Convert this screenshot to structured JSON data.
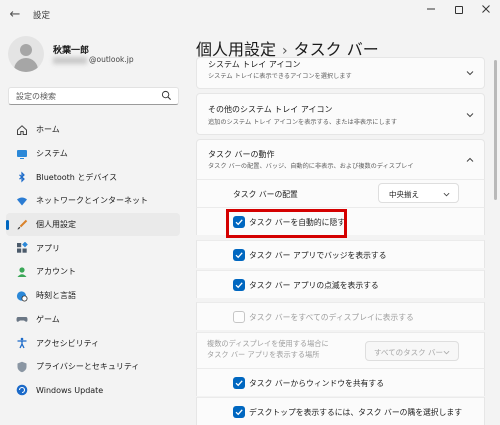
{
  "window": {
    "title": "設定",
    "back_glyph": "←"
  },
  "user": {
    "name": "秋葉一郎",
    "email_suffix": "@outlook.jp"
  },
  "search": {
    "placeholder": "設定の検索"
  },
  "sidebar": {
    "items": [
      {
        "label": "ホーム",
        "icon": "home-icon",
        "active": false
      },
      {
        "label": "システム",
        "icon": "monitor-icon",
        "active": false
      },
      {
        "label": "Bluetooth とデバイス",
        "icon": "bluetooth-icon",
        "active": false
      },
      {
        "label": "ネットワークとインターネット",
        "icon": "wifi-icon",
        "active": false
      },
      {
        "label": "個人用設定",
        "icon": "brush-icon",
        "active": true
      },
      {
        "label": "アプリ",
        "icon": "apps-icon",
        "active": false
      },
      {
        "label": "アカウント",
        "icon": "person-icon",
        "active": false
      },
      {
        "label": "時刻と言語",
        "icon": "globe-clock-icon",
        "active": false
      },
      {
        "label": "ゲーム",
        "icon": "gamepad-icon",
        "active": false
      },
      {
        "label": "アクセシビリティ",
        "icon": "accessibility-icon",
        "active": false
      },
      {
        "label": "プライバシーとセキュリティ",
        "icon": "shield-icon",
        "active": false
      },
      {
        "label": "Windows Update",
        "icon": "update-icon",
        "active": false
      }
    ]
  },
  "header": {
    "parent": "個人用設定",
    "separator": "›",
    "current": "タスク バー"
  },
  "cards": {
    "tray_icons": {
      "title": "システム トレイ アイコン",
      "subtitle": "システム トレイに表示できるアイコンを選択します"
    },
    "other_tray_icons": {
      "title": "その他のシステム トレイ アイコン",
      "subtitle": "追加のシステム トレイ アイコンを表示する、または非表示にします"
    },
    "behaviors": {
      "title": "タスク バーの動作",
      "subtitle": "タスク バーの配置、バッジ、自動的に非表示、および複数のディスプレイ"
    }
  },
  "behaviors": {
    "alignment": {
      "label": "タスク バーの配置",
      "value": "中央揃え"
    },
    "autohide": {
      "label": "タスク バーを自動的に隠す",
      "checked": true
    },
    "badges": {
      "label": "タスク バー アプリでバッジを表示する",
      "checked": true
    },
    "flashing": {
      "label": "タスク バー アプリの点滅を表示する",
      "checked": true
    },
    "all_displays": {
      "label": "タスク バーをすべてのディスプレイに表示する",
      "checked": false,
      "disabled": true
    },
    "multi_display": {
      "label_line1": "複数のディスプレイを使用する場合に",
      "label_line2": "タスク バー アプリを表示する場所",
      "value": "すべてのタスク バー",
      "disabled": true
    },
    "share_window": {
      "label": "タスク バーからウィンドウを共有する",
      "checked": true
    },
    "show_desktop": {
      "label": "デスクトップを表示するには、タスク バーの隅を選択します",
      "checked": true
    }
  },
  "colors": {
    "accent": "#0067c0",
    "highlight": "#d40000"
  }
}
